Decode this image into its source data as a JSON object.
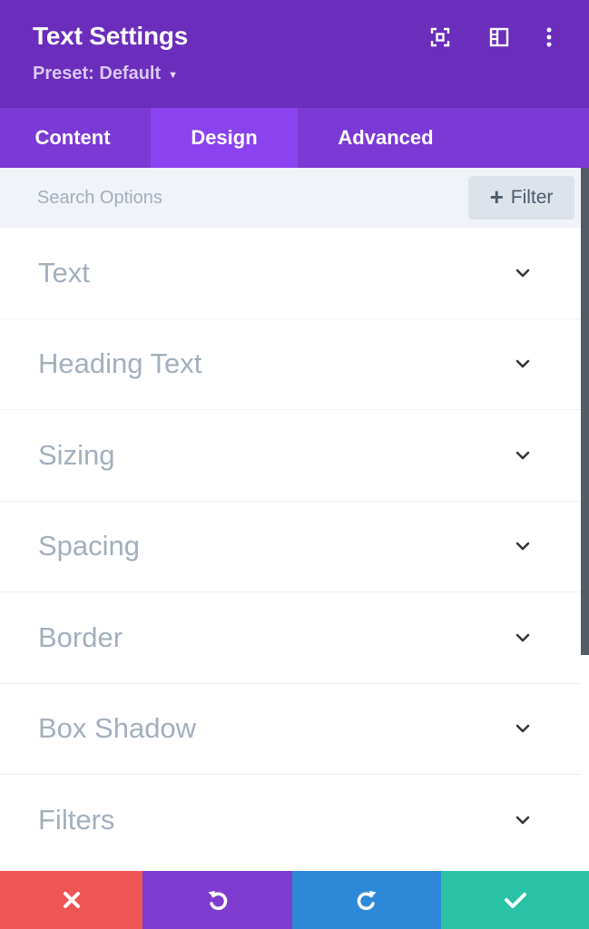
{
  "header": {
    "title": "Text Settings",
    "preset_label": "Preset: Default",
    "icons": [
      "focus-mode-icon",
      "split-view-icon",
      "more-options-icon"
    ]
  },
  "tabs": [
    {
      "label": "Content",
      "active": false
    },
    {
      "label": "Design",
      "active": true
    },
    {
      "label": "Advanced",
      "active": false
    }
  ],
  "search": {
    "placeholder": "Search Options",
    "value": "",
    "filter_label": "Filter"
  },
  "groups": [
    {
      "label": "Text"
    },
    {
      "label": "Heading Text"
    },
    {
      "label": "Sizing"
    },
    {
      "label": "Spacing"
    },
    {
      "label": "Border"
    },
    {
      "label": "Box Shadow"
    },
    {
      "label": "Filters"
    }
  ],
  "footer": {
    "icons": [
      "close-icon",
      "undo-icon",
      "redo-icon",
      "check-icon"
    ]
  },
  "colors": {
    "header_bg": "#6b2dbc",
    "tabs_bg": "#7b39d5",
    "active_tab_bg": "#8a43ee",
    "cancel": "#ef5555",
    "undo": "#7d3bcf",
    "redo": "#2c89d8",
    "save": "#29c2a6"
  }
}
